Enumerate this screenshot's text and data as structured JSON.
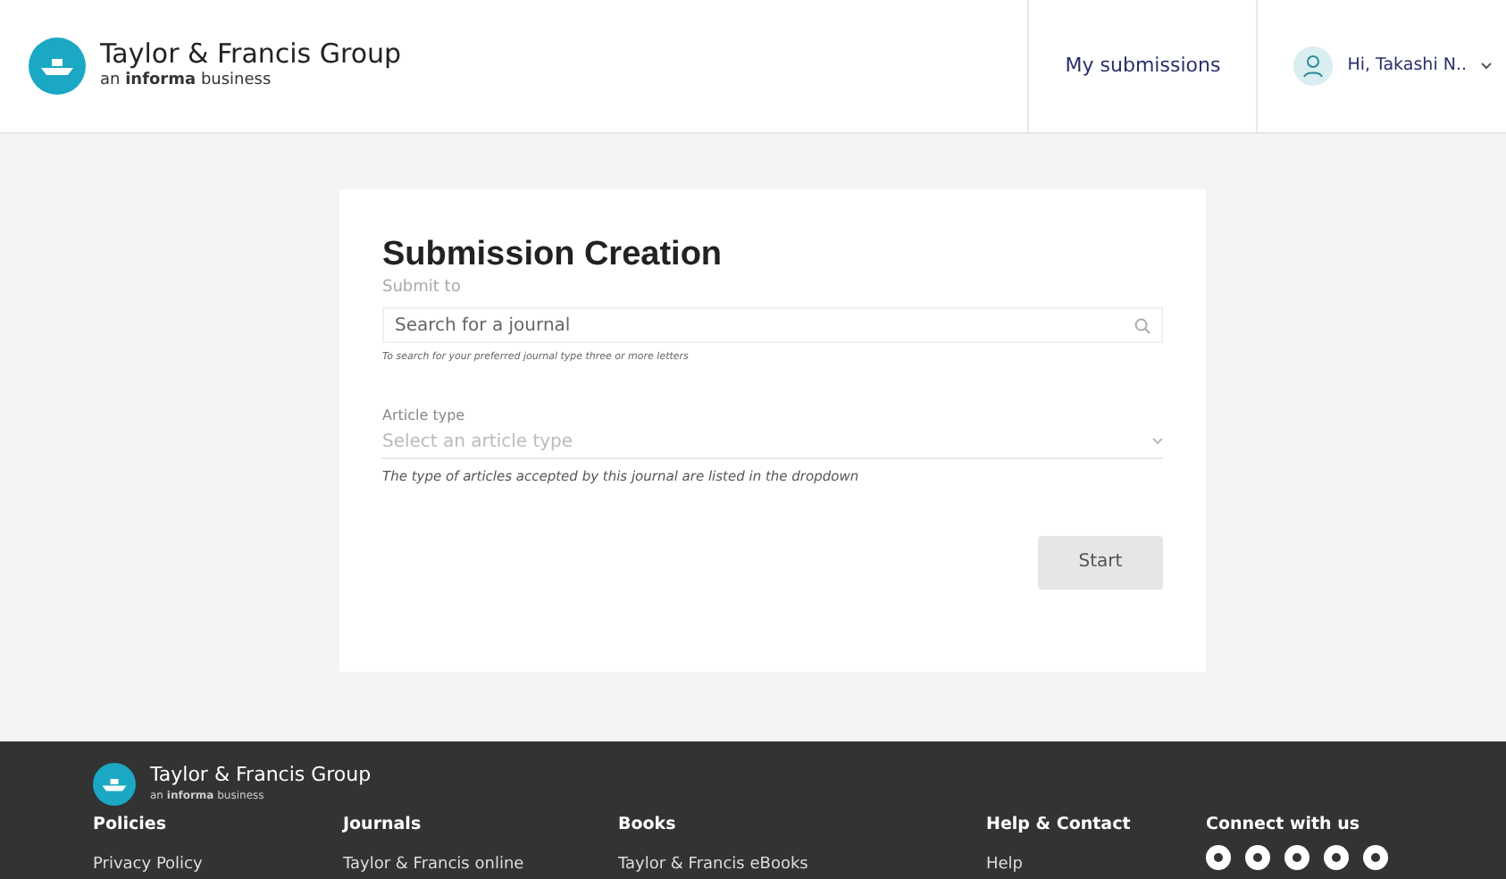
{
  "header": {
    "logo_title": "Taylor & Francis Group",
    "logo_subtitle": "an **informa** business",
    "nav_link": "My submissions",
    "user": "Hi, Takashi N.."
  },
  "form": {
    "title": "Submission Creation",
    "journal_label": "Submit to",
    "journal_placeholder": "Search for a journal",
    "journal_hint": "To search for your preferred journal type three or more letters",
    "article_label": "Article type",
    "article_placeholder": "Select an article type",
    "article_hint": "The type of articles accepted by this journal are listed in the dropdown",
    "button": {
      "label": "Start",
      "disabled": true
    }
  },
  "footer": {
    "logo_title": "Taylor & Francis Group",
    "logo_subtitle": "an **informa** business",
    "columns": [
      {
        "heading": "Policies",
        "link": "Privacy Policy"
      },
      {
        "heading": "Journals",
        "link": "Taylor & Francis online"
      },
      {
        "heading": "Books",
        "link": "Taylor & Francis eBooks"
      },
      {
        "heading": "Help & Contact",
        "link": "Help"
      }
    ],
    "social_heading": "Connect with us"
  }
}
